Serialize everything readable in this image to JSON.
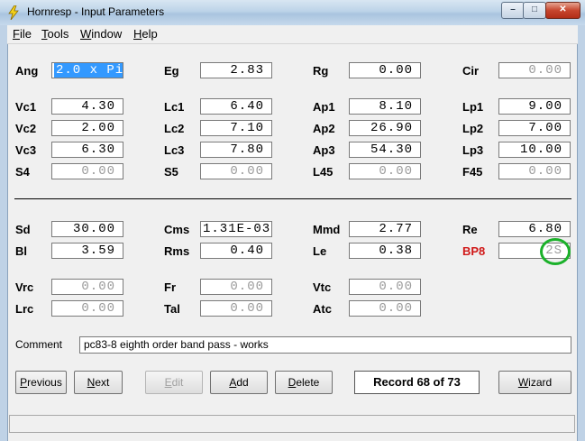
{
  "window": {
    "title": "Hornresp - Input Parameters",
    "minimize": "–",
    "maximize": "□",
    "close": "✕"
  },
  "menu": [
    {
      "label_u": "F",
      "label_rest": "ile"
    },
    {
      "label_u": "T",
      "label_rest": "ools"
    },
    {
      "label_u": "W",
      "label_rest": "indow"
    },
    {
      "label_u": "H",
      "label_rest": "elp"
    }
  ],
  "params": {
    "ang": {
      "label": "Ang",
      "value": "2.0 x Pi"
    },
    "eg": {
      "label": "Eg",
      "value": "2.83"
    },
    "rg": {
      "label": "Rg",
      "value": "0.00"
    },
    "cir": {
      "label": "Cir",
      "value": "0.00"
    },
    "vc1": {
      "label": "Vc1",
      "value": "4.30"
    },
    "lc1": {
      "label": "Lc1",
      "value": "6.40"
    },
    "ap1": {
      "label": "Ap1",
      "value": "8.10"
    },
    "lp1": {
      "label": "Lp1",
      "value": "9.00"
    },
    "vc2": {
      "label": "Vc2",
      "value": "2.00"
    },
    "lc2": {
      "label": "Lc2",
      "value": "7.10"
    },
    "ap2": {
      "label": "Ap2",
      "value": "26.90"
    },
    "lp2": {
      "label": "Lp2",
      "value": "7.00"
    },
    "vc3": {
      "label": "Vc3",
      "value": "6.30"
    },
    "lc3": {
      "label": "Lc3",
      "value": "7.80"
    },
    "ap3": {
      "label": "Ap3",
      "value": "54.30"
    },
    "lp3": {
      "label": "Lp3",
      "value": "10.00"
    },
    "s4": {
      "label": "S4",
      "value": "0.00"
    },
    "s5": {
      "label": "S5",
      "value": "0.00"
    },
    "l45": {
      "label": "L45",
      "value": "0.00"
    },
    "f45": {
      "label": "F45",
      "value": "0.00"
    },
    "sd": {
      "label": "Sd",
      "value": "30.00"
    },
    "cms": {
      "label": "Cms",
      "value": "1.31E-03"
    },
    "mmd": {
      "label": "Mmd",
      "value": "2.77"
    },
    "re": {
      "label": "Re",
      "value": "6.80"
    },
    "bl": {
      "label": "Bl",
      "value": "3.59"
    },
    "rms": {
      "label": "Rms",
      "value": "0.40"
    },
    "le": {
      "label": "Le",
      "value": "0.38"
    },
    "bp8": {
      "label": "BP8",
      "value": "2S"
    },
    "vrc": {
      "label": "Vrc",
      "value": "0.00"
    },
    "fr": {
      "label": "Fr",
      "value": "0.00"
    },
    "vtc": {
      "label": "Vtc",
      "value": "0.00"
    },
    "lrc": {
      "label": "Lrc",
      "value": "0.00"
    },
    "tal": {
      "label": "Tal",
      "value": "0.00"
    },
    "atc": {
      "label": "Atc",
      "value": "0.00"
    }
  },
  "comment": {
    "label": "Comment",
    "value": "pc83-8 eighth order band pass - works"
  },
  "buttons": {
    "previous": {
      "u": "P",
      "rest": "revious"
    },
    "next": {
      "u": "N",
      "rest": "ext"
    },
    "edit": {
      "u": "E",
      "rest": "dit"
    },
    "add": {
      "u": "A",
      "rest": "dd"
    },
    "delete": {
      "u": "D",
      "rest": "elete"
    },
    "wizard": {
      "u": "W",
      "rest": "izard"
    }
  },
  "record": "Record 68 of 73",
  "colors": {
    "highlight_circle": "#1bb12a",
    "bp8_label": "#d01818",
    "selection": "#3399ff"
  }
}
